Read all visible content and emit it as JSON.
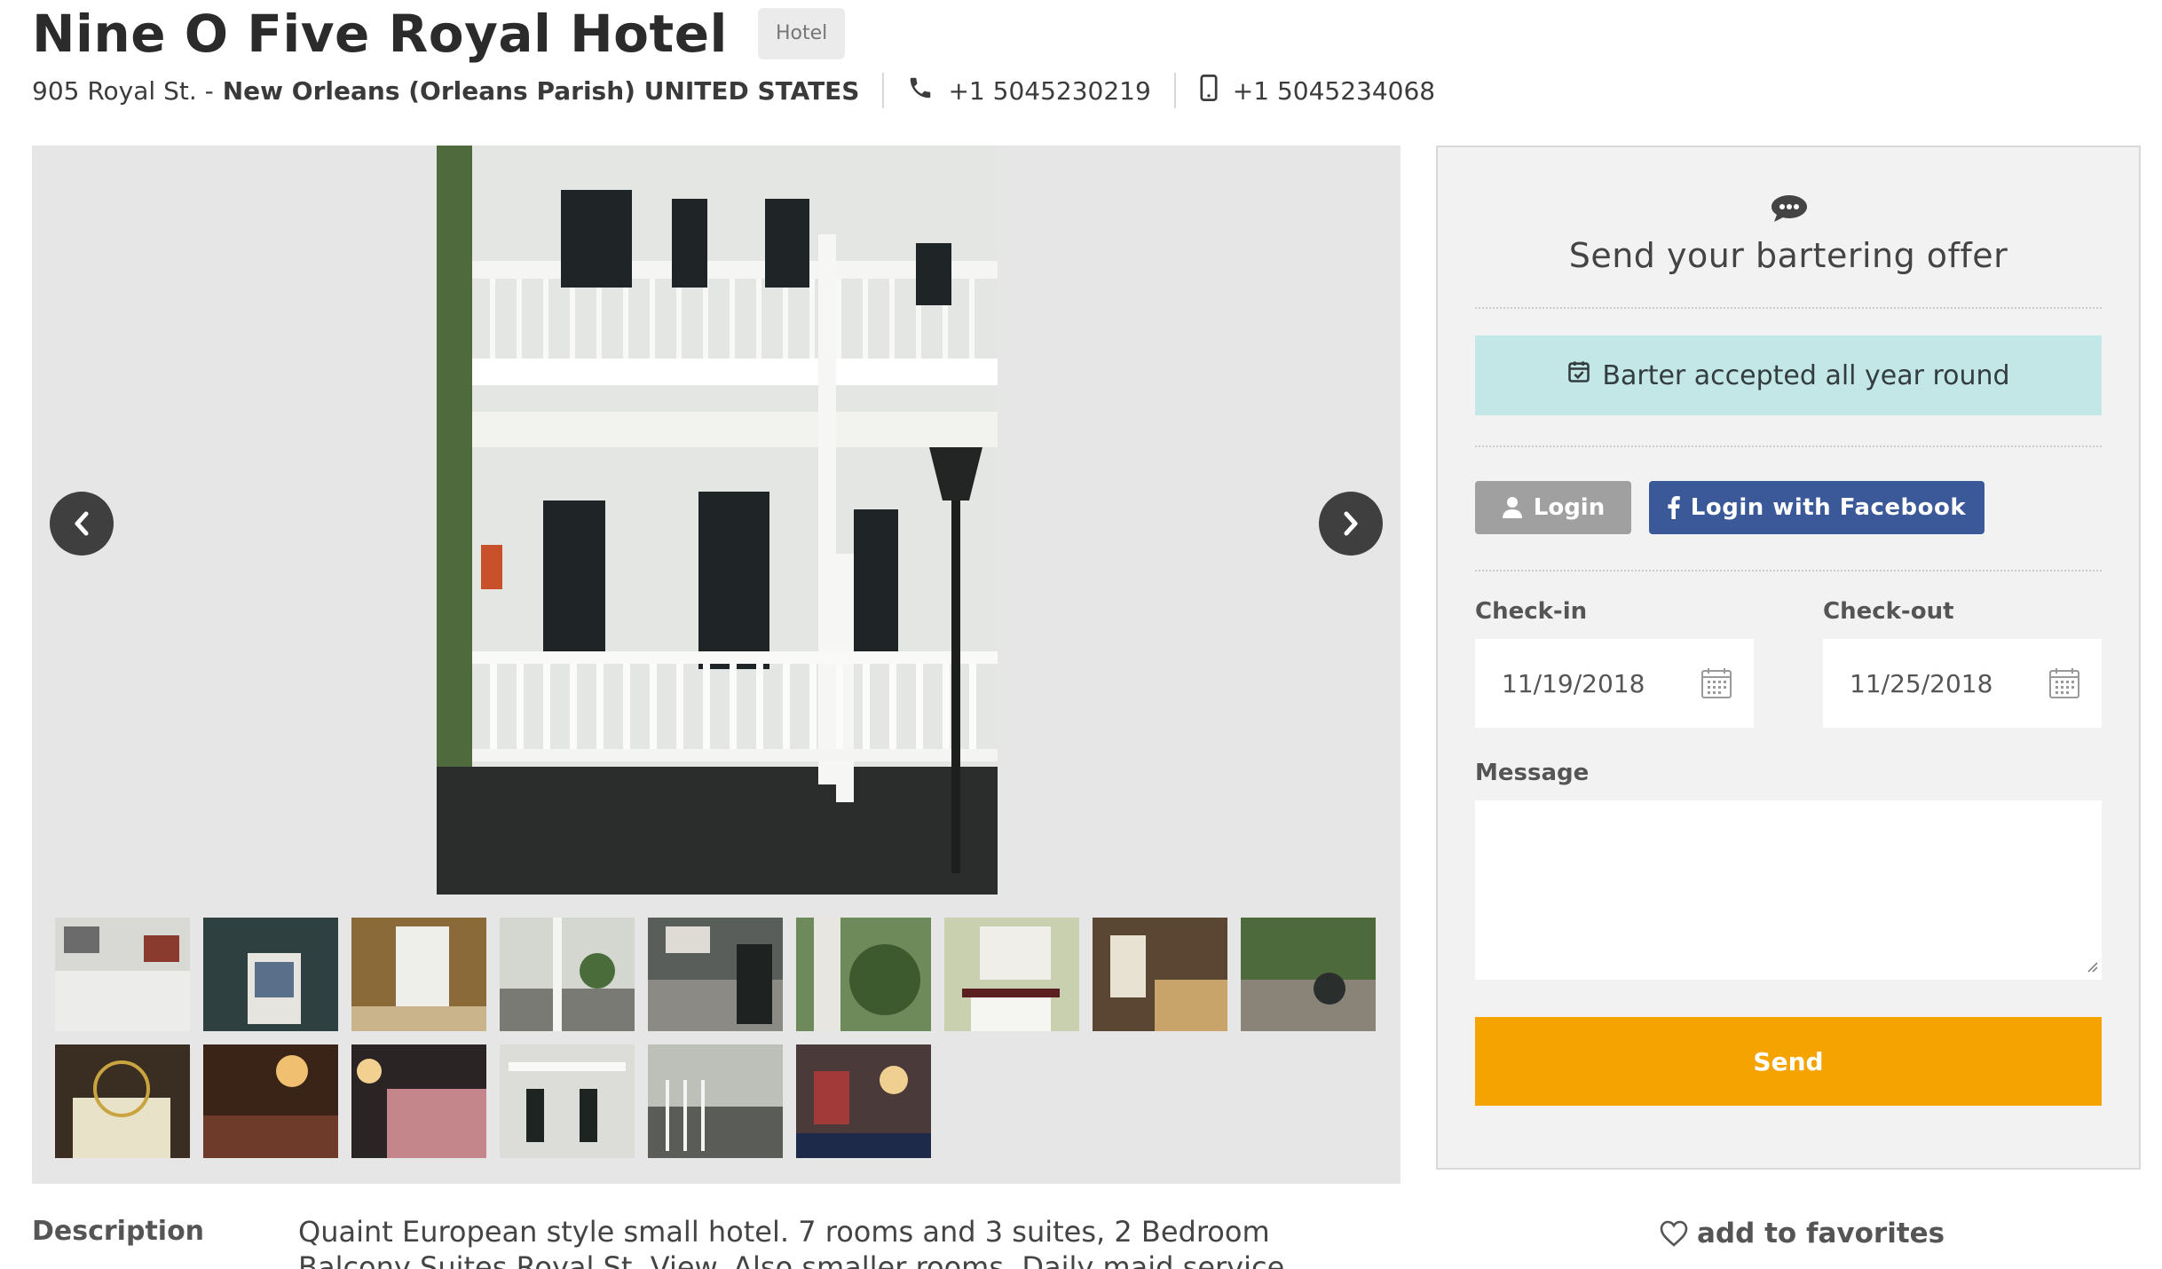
{
  "hotel": {
    "name": "Nine O Five Royal Hotel",
    "category_badge": "Hotel",
    "street": "905 Royal St. -",
    "city": "New Orleans (Orleans Parish) UNITED STATES",
    "phone": "+1 5045230219",
    "mobile": "+1 5045234068"
  },
  "gallery": {
    "prev_icon": "chevron-left-icon",
    "next_icon": "chevron-right-icon",
    "thumbnail_count": 15
  },
  "offer_form": {
    "title": "Send your bartering offer",
    "barter_notice": "Barter accepted all year round",
    "login_label": "Login",
    "facebook_login_label": "Login with Facebook",
    "checkin_label": "Check-in",
    "checkin_value": "11/19/2018",
    "checkout_label": "Check-out",
    "checkout_value": "11/25/2018",
    "message_label": "Message",
    "message_value": "",
    "send_label": "Send"
  },
  "description": {
    "label": "Description",
    "text": "Quaint European style small hotel. 7 rooms and 3 suites, 2 Bedroom Balcony Suites Royal St. View. Also smaller rooms. Daily maid service. Small kitchenette in"
  },
  "favorites": {
    "label": "add to favorites"
  },
  "colors": {
    "send_button": "#f4a300",
    "facebook_button": "#3b5998",
    "barter_notice_bg": "#c3e6e6",
    "login_button": "#a0a0a0"
  }
}
